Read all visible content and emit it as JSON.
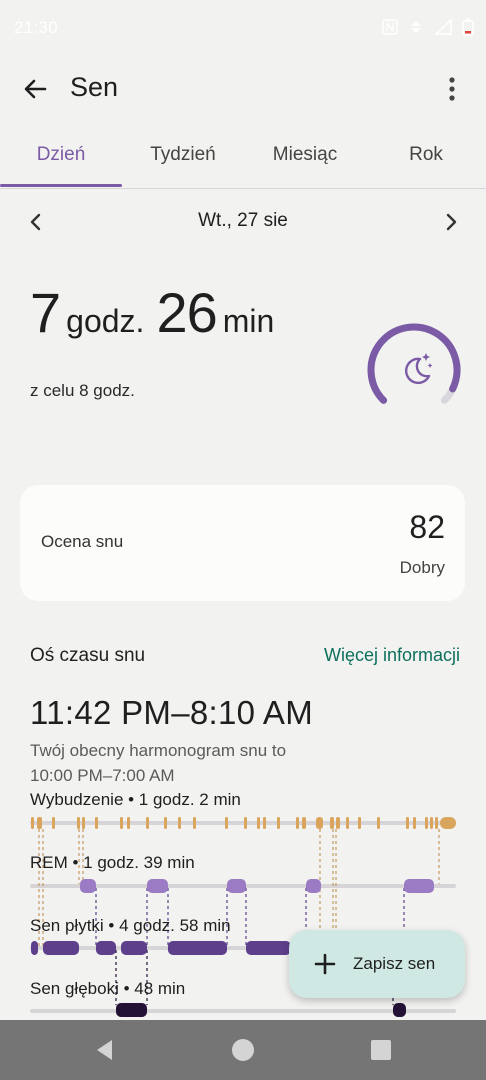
{
  "status_bar": {
    "time": "21:30",
    "icons": [
      "nfc-icon",
      "data-icon",
      "signal-icon",
      "battery-icon"
    ]
  },
  "app_bar": {
    "title": "Sen",
    "back_icon": "arrow-back-icon",
    "menu_icon": "more-vert-icon"
  },
  "tabs": [
    {
      "label": "Dzień",
      "active": true
    },
    {
      "label": "Tydzień",
      "active": false
    },
    {
      "label": "Miesiąc",
      "active": false
    },
    {
      "label": "Rok",
      "active": false
    }
  ],
  "date_nav": {
    "date": "Wt., 27 sie",
    "prev_icon": "chevron-left-icon",
    "next_icon": "chevron-right-icon"
  },
  "summary": {
    "hours": "7",
    "hours_unit": "godz.",
    "minutes": "26",
    "minutes_unit": "min",
    "goal_text": "z celu 8 godz.",
    "goal_progress": 0.93,
    "ring_icon": "moon-stars-icon"
  },
  "sleep_score": {
    "label": "Ocena snu",
    "value": "82",
    "quality": "Dobry"
  },
  "timeline": {
    "title": "Oś czasu snu",
    "more_link": "Więcej informacji",
    "time_range": "11:42 PM–8:10 AM",
    "schedule_line1": "Twój obecny harmonogram snu to",
    "schedule_line2": "10:00 PM–7:00 AM",
    "stages": [
      {
        "label": "Wybudzenie • 1 godz. 2 min"
      },
      {
        "label": "REM • 1 godz. 39 min"
      },
      {
        "label": "Sen płytki • 4 godz. 58 min"
      },
      {
        "label": "Sen głęboki • 48 min"
      }
    ]
  },
  "colors": {
    "accent": "#7b5ba6",
    "awake": "#d9a55c",
    "rem": "#9b7cc4",
    "light": "#5d3f8c",
    "deep": "#231236",
    "link": "#0e6f5c",
    "fab_bg": "#cfe8e3"
  },
  "fab": {
    "label": "Zapisz sen",
    "icon": "plus-icon"
  },
  "nav_bar": {
    "back_icon": "nav-back-icon",
    "home_icon": "nav-home-icon",
    "recents_icon": "nav-recents-icon"
  }
}
